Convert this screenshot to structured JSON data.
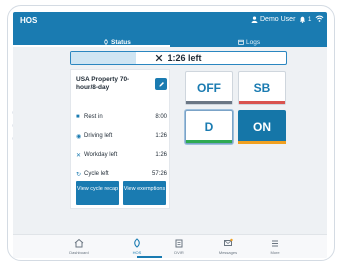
{
  "app_title": "HOS",
  "user": {
    "name": "Demo User"
  },
  "notifications": {
    "count": "1"
  },
  "tabs": [
    {
      "label": "Status",
      "icon": "status-icon",
      "active": true
    },
    {
      "label": "Logs",
      "icon": "logs-icon",
      "active": false
    }
  ],
  "timer": {
    "label": "1:26 left",
    "icon": "tools-icon",
    "progress_fraction": 0.3
  },
  "clocks": {
    "ruleset": "USA Property 70-hour/8-day",
    "rows": [
      {
        "icon": "rest-icon",
        "label": "Rest in",
        "value": "8:00"
      },
      {
        "icon": "driving-icon",
        "label": "Driving left",
        "value": "1:26"
      },
      {
        "icon": "tools-icon",
        "label": "Workday left",
        "value": "1:26"
      },
      {
        "icon": "cycle-icon",
        "label": "Cycle left",
        "value": "57:26"
      }
    ],
    "buttons": {
      "recap": "View cycle recap",
      "exemptions": "View exemptions"
    }
  },
  "statuses": [
    {
      "label": "OFF",
      "strip_color": "#6b7785",
      "active": false
    },
    {
      "label": "SB",
      "strip_color": "#d9534f",
      "active": false
    },
    {
      "label": "D",
      "strip_color": "#2eaa52",
      "active": false
    },
    {
      "label": "ON",
      "strip_color": "#f0a020",
      "active": true
    }
  ],
  "nav": [
    {
      "label": "Dashboard",
      "icon": "home-icon"
    },
    {
      "label": "HOS",
      "icon": "hos-icon",
      "active": true
    },
    {
      "label": "DVIR",
      "icon": "dvir-icon"
    },
    {
      "label": "Messages",
      "icon": "messages-icon"
    },
    {
      "label": "More",
      "icon": "menu-icon"
    }
  ],
  "colors": {
    "primary": "#1a7bb1",
    "active_status": "#1576a8",
    "background": "#eef1f4"
  }
}
